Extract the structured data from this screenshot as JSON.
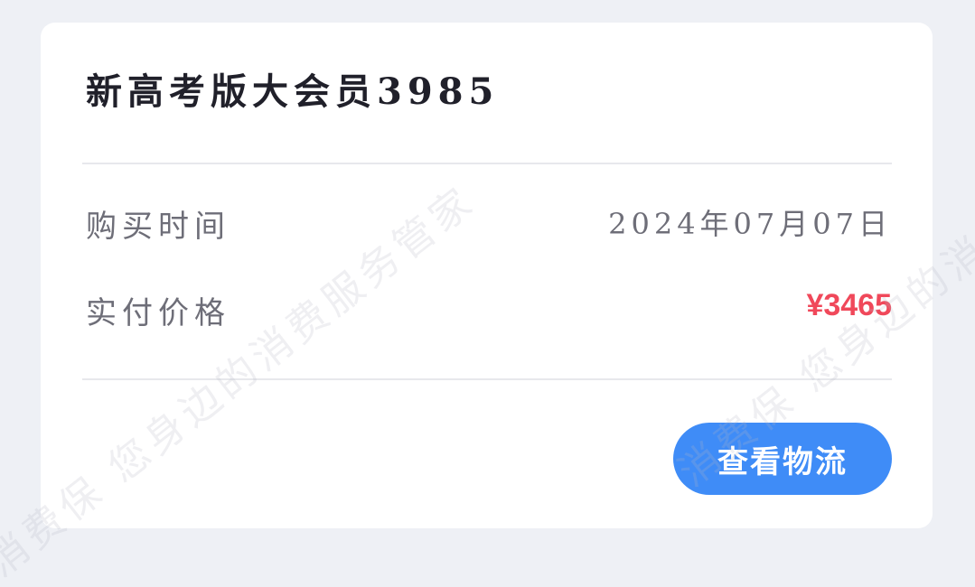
{
  "card": {
    "title": "新高考版大会员3985",
    "purchase_time": {
      "label": "购买时间",
      "value": "2024年07月07日"
    },
    "paid_price": {
      "label": "实付价格",
      "value": "¥3465"
    },
    "logistics_button_label": "查看物流"
  },
  "watermark": {
    "text": "消费保 您身边的消费服务管家"
  },
  "colors": {
    "background": "#eef0f5",
    "card": "#ffffff",
    "price": "#f0485a",
    "button": "#3f8cf7",
    "divider": "#e7e8ec"
  }
}
